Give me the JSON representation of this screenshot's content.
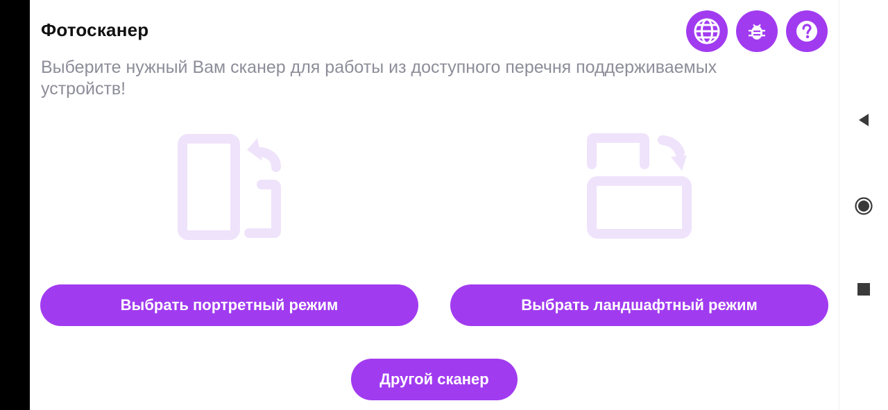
{
  "app": {
    "title": "Фотосканер",
    "subtitle": "Выберите нужный Вам сканер для работы из доступного перечня поддерживаемых устройств!"
  },
  "header_icons": [
    {
      "name": "language-icon"
    },
    {
      "name": "bug-icon"
    },
    {
      "name": "help-icon"
    }
  ],
  "buttons": {
    "portrait": "Выбрать портретный режим",
    "landscape": "Выбрать ландшафтный режим",
    "other": "Другой сканер"
  },
  "colors": {
    "accent": "#a13bf0",
    "illustration": "#efe3fb",
    "subtitle": "#8d8d99"
  },
  "system_nav": [
    "back-icon",
    "home-icon",
    "recents-icon"
  ]
}
